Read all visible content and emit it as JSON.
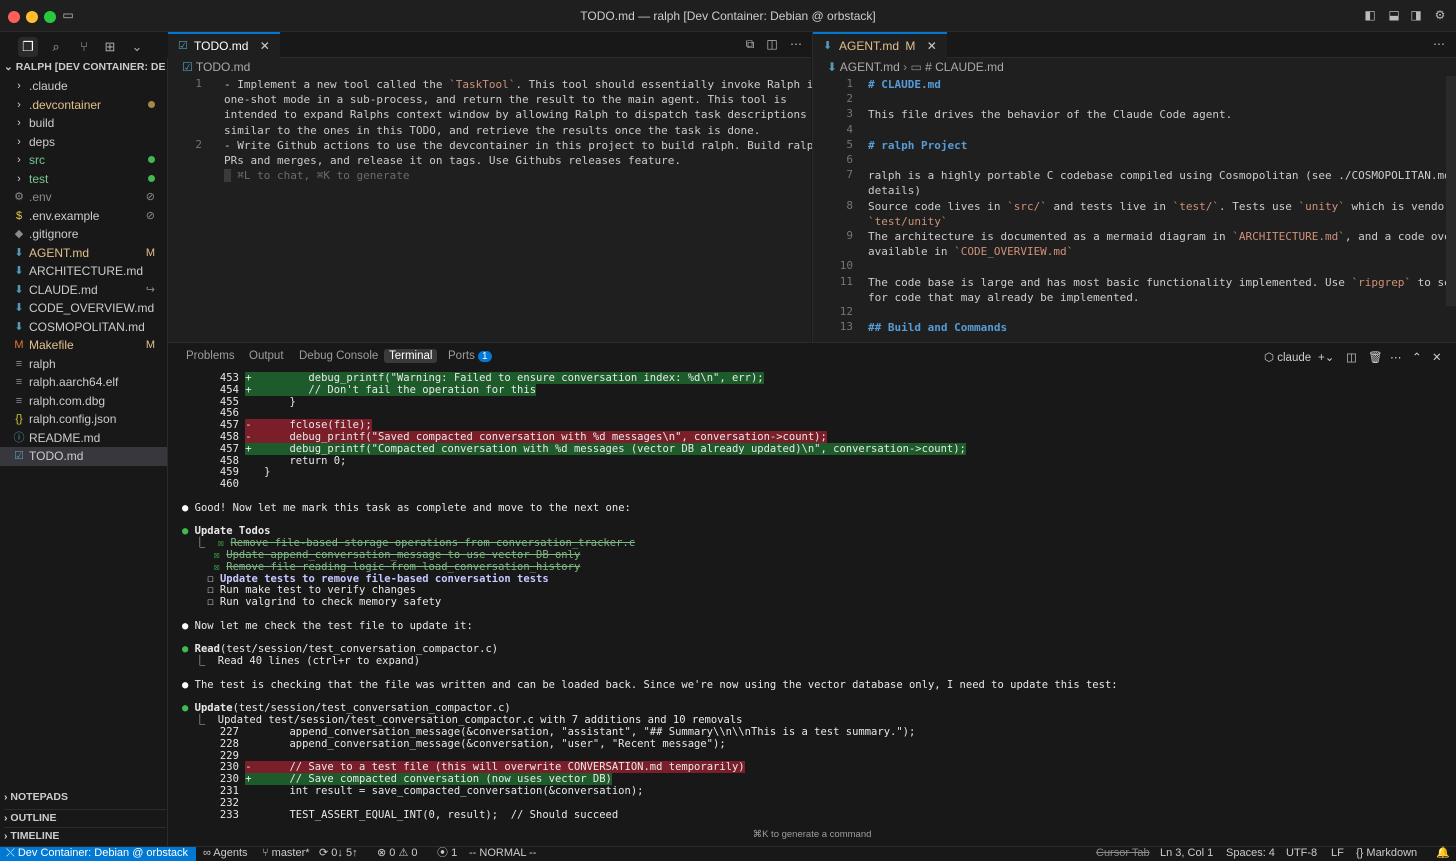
{
  "window": {
    "title": "TODO.md — ralph [Dev Container: Debian @ orbstack]"
  },
  "explorer": {
    "root": "RALPH [DEV CONTAINER: DEB...",
    "items": [
      {
        "name": ".claude",
        "icon": "chevron",
        "color": "#cccccc",
        "status": ""
      },
      {
        "name": ".devcontainer",
        "icon": "chevron",
        "color": "#e2c08d",
        "status": "dot",
        "statusColor": "#a58a44"
      },
      {
        "name": "build",
        "icon": "chevron",
        "color": "#cccccc",
        "status": ""
      },
      {
        "name": "deps",
        "icon": "chevron",
        "color": "#cccccc",
        "status": ""
      },
      {
        "name": "src",
        "icon": "chevron",
        "color": "#73c991",
        "status": "dot",
        "statusColor": "#3fb950"
      },
      {
        "name": "test",
        "icon": "chevron",
        "color": "#73c991",
        "status": "dot",
        "statusColor": "#3fb950"
      },
      {
        "name": ".env",
        "icon": "gear",
        "color": "#8b8b8b",
        "status": "⊘"
      },
      {
        "name": ".env.example",
        "icon": "dollar",
        "color": "#cccccc",
        "status": "⊘"
      },
      {
        "name": ".gitignore",
        "icon": "diamond",
        "color": "#cccccc",
        "status": ""
      },
      {
        "name": "AGENT.md",
        "icon": "md",
        "color": "#e2c08d",
        "status": "M"
      },
      {
        "name": "ARCHITECTURE.md",
        "icon": "md",
        "color": "#cccccc",
        "status": ""
      },
      {
        "name": "CLAUDE.md",
        "icon": "md",
        "color": "#cccccc",
        "status": "↪"
      },
      {
        "name": "CODE_OVERVIEW.md",
        "icon": "md",
        "color": "#cccccc",
        "status": ""
      },
      {
        "name": "COSMOPOLITAN.md",
        "icon": "md",
        "color": "#cccccc",
        "status": ""
      },
      {
        "name": "Makefile",
        "icon": "make",
        "color": "#e2c08d",
        "status": "M"
      },
      {
        "name": "ralph",
        "icon": "lines",
        "color": "#cccccc",
        "status": ""
      },
      {
        "name": "ralph.aarch64.elf",
        "icon": "lines",
        "color": "#cccccc",
        "status": ""
      },
      {
        "name": "ralph.com.dbg",
        "icon": "lines",
        "color": "#cccccc",
        "status": ""
      },
      {
        "name": "ralph.config.json",
        "icon": "json",
        "color": "#cccccc",
        "status": ""
      },
      {
        "name": "README.md",
        "icon": "info",
        "color": "#cccccc",
        "status": ""
      },
      {
        "name": "TODO.md",
        "icon": "todo",
        "color": "#cccccc",
        "status": ""
      }
    ],
    "sections": [
      "NOTEPADS",
      "OUTLINE",
      "TIMELINE"
    ]
  },
  "editor_left": {
    "tab": "TODO.md",
    "breadcrumb": "TODO.md",
    "lines": [
      {
        "n": "1",
        "text": "- Implement a new tool called the `TaskTool`. This tool should essentially invoke Ralph in\none-shot mode in a sub-process, and return the result to the main agent. This tool is\nintended to expand Ralphs context window by allowing Ralph to dispatch task descriptions\nsimilar to the ones in this TODO, and retrieve the results once the task is done."
      },
      {
        "n": "2",
        "text": "- Write Github actions to use the devcontainer in this project to build ralph. Build ralph on\nPRs and merges, and release it on tags. Use Githubs releases feature."
      }
    ],
    "hint": "⌘L to chat, ⌘K to generate"
  },
  "editor_right": {
    "tab": "AGENT.md",
    "tab_status": "M",
    "breadcrumb_file": "AGENT.md",
    "breadcrumb_section": "# CLAUDE.md",
    "lines": [
      {
        "n": "1",
        "text": "# CLAUDE.md",
        "style": "h"
      },
      {
        "n": "2",
        "text": ""
      },
      {
        "n": "3",
        "text": "This file drives the behavior of the Claude Code agent."
      },
      {
        "n": "4",
        "text": ""
      },
      {
        "n": "5",
        "text": "# ralph Project",
        "style": "h"
      },
      {
        "n": "6",
        "text": ""
      },
      {
        "n": "7",
        "text": "ralph is a highly portable C codebase compiled using Cosmopolitan (see ./COSMOPOLITAN.md for\ndetails)"
      },
      {
        "n": "8",
        "text": "Source code lives in `src/` and tests live in `test/`. Tests use `unity` which is vendored in\n`test/unity`"
      },
      {
        "n": "9",
        "text": "The architecture is documented as a mermaid diagram in `ARCHITECTURE.md`, and a code overview\navailable in `CODE_OVERVIEW.md`"
      },
      {
        "n": "10",
        "text": ""
      },
      {
        "n": "11",
        "text": "The code base is large and has most basic functionality implemented. Use `ripgrep` to search\nfor code that may already be implemented."
      },
      {
        "n": "12",
        "text": ""
      },
      {
        "n": "13",
        "text": "## Build and Commands",
        "style": "h"
      }
    ]
  },
  "panel": {
    "tabs": [
      "Problems",
      "Output",
      "Debug Console",
      "Terminal",
      "Ports"
    ],
    "ports_count": "1",
    "terminal_name": "claude",
    "lines": [
      {
        "t": "      453 +         debug_printf(\"Warning: Failed to ensure conversation index: %d\\n\", err);",
        "k": "add"
      },
      {
        "t": "      454 +         // Don't fail the operation for this",
        "k": "add"
      },
      {
        "t": "      455        }",
        "k": ""
      },
      {
        "t": "      456",
        "k": ""
      },
      {
        "t": "      457 -      fclose(file);",
        "k": "del"
      },
      {
        "t": "      458 -      debug_printf(\"Saved compacted conversation with %d messages\\n\", conversation->count);",
        "k": "del"
      },
      {
        "t": "      457 +      debug_printf(\"Compacted conversation with %d messages (vector DB already updated)\\n\", conversation->count);",
        "k": "add"
      },
      {
        "t": "      458        return 0;",
        "k": ""
      },
      {
        "t": "      459    }",
        "k": ""
      },
      {
        "t": "      460",
        "k": ""
      },
      {
        "t": "",
        "k": ""
      },
      {
        "t": "● Good! Now let me mark this task as complete and move to the next one:",
        "k": "msg"
      },
      {
        "t": "",
        "k": ""
      },
      {
        "t": "● Update Todos",
        "k": "tool"
      },
      {
        "t": "  ⎿ ☒ Remove file-based storage operations from conversation_tracker.c",
        "k": "done"
      },
      {
        "t": "    ☒ Update append_conversation_message to use vector DB only",
        "k": "done"
      },
      {
        "t": "    ☒ Remove file reading logic from load_conversation_history",
        "k": "done"
      },
      {
        "t": "    ☐ Update tests to remove file-based conversation tests",
        "k": "cur"
      },
      {
        "t": "    ☐ Run make test to verify changes",
        "k": ""
      },
      {
        "t": "    ☐ Run valgrind to check memory safety",
        "k": ""
      },
      {
        "t": "",
        "k": ""
      },
      {
        "t": "● Now let me check the test file to update it:",
        "k": "msg"
      },
      {
        "t": "",
        "k": ""
      },
      {
        "t": "● Read(test/session/test_conversation_compactor.c)",
        "k": "tool"
      },
      {
        "t": "  ⎿  Read 40 lines (ctrl+r to expand)",
        "k": ""
      },
      {
        "t": "",
        "k": ""
      },
      {
        "t": "● The test is checking that the file was written and can be loaded back. Since we're now using the vector database only, I need to update this test:",
        "k": "msg"
      },
      {
        "t": "",
        "k": ""
      },
      {
        "t": "● Update(test/session/test_conversation_compactor.c)",
        "k": "tool"
      },
      {
        "t": "  ⎿  Updated test/session/test_conversation_compactor.c with 7 additions and 10 removals",
        "k": ""
      },
      {
        "t": "      227        append_conversation_message(&conversation, \"assistant\", \"## Summary\\\\n\\\\nThis is a test summary.\");",
        "k": ""
      },
      {
        "t": "      228        append_conversation_message(&conversation, \"user\", \"Recent message\");",
        "k": ""
      },
      {
        "t": "      229",
        "k": ""
      },
      {
        "t": "      230 -      // Save to a test file (this will overwrite CONVERSATION.md temporarily)",
        "k": "del"
      },
      {
        "t": "      230 +      // Save compacted conversation (now uses vector DB)",
        "k": "add"
      },
      {
        "t": "      231        int result = save_compacted_conversation(&conversation);",
        "k": ""
      },
      {
        "t": "      232",
        "k": ""
      },
      {
        "t": "      233        TEST_ASSERT_EQUAL_INT(0, result);  // Should succeed",
        "k": ""
      }
    ],
    "hint": "⌘K to generate a command"
  },
  "statusbar": {
    "remote": "Dev Container: Debian @ orbstack",
    "agents": "Agents",
    "branch": "master*",
    "sync": "0↓ 5↑",
    "problems": "⊗ 0 ⚠ 0",
    "ports": "1",
    "mode": "-- NORMAL --",
    "cursor_tab": "Cursor Tab",
    "position": "Ln 3, Col 1",
    "spaces": "Spaces: 4",
    "encoding": "UTF-8",
    "eol": "LF",
    "language": "Markdown"
  },
  "colors": {
    "accent": "#0078d4",
    "remote": "#0078d4",
    "add_bg": "#1d5b2a",
    "del_bg": "#7a1f2a"
  }
}
